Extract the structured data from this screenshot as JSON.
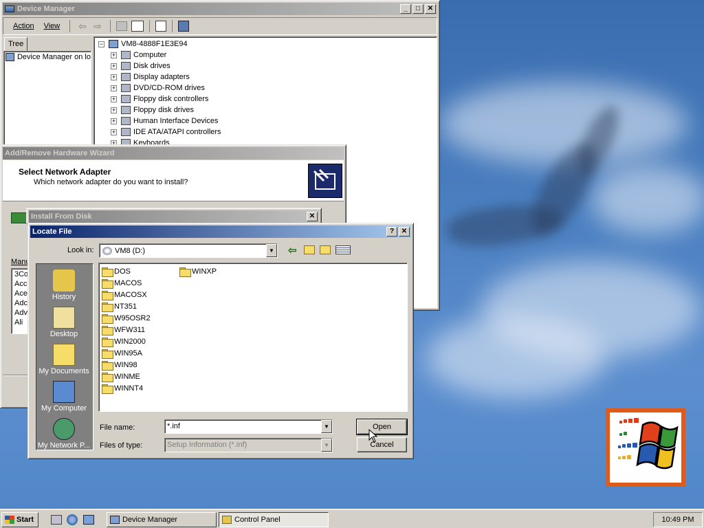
{
  "device_manager": {
    "title": "Device Manager",
    "menu": {
      "action": "Action",
      "view": "View"
    },
    "tab": "Tree",
    "left_item": "Device Manager on lo",
    "root": "VM8-4888F1E3E94",
    "categories": [
      "Computer",
      "Disk drives",
      "Display adapters",
      "DVD/CD-ROM drives",
      "Floppy disk controllers",
      "Floppy disk drives",
      "Human Interface Devices",
      "IDE ATA/ATAPI controllers",
      "Keyboards"
    ]
  },
  "wizard": {
    "title": "Add/Remove Hardware Wizard",
    "heading": "Select Network Adapter",
    "subheading": "Which network adapter do you want to install?",
    "manufacturer_label": "Manu",
    "manufacturers": [
      "3Co",
      "Acc",
      "Ace",
      "Adc",
      "Adv",
      "Ali"
    ]
  },
  "install_from_disk": {
    "title": "Install From Disk"
  },
  "locate_file": {
    "title": "Locate File",
    "look_in_label": "Look in:",
    "look_in_value": "VM8 (D:)",
    "places": [
      "History",
      "Desktop",
      "My Documents",
      "My Computer",
      "My Network P..."
    ],
    "folders_col1": [
      "DOS",
      "MACOS",
      "MACOSX",
      "NT351",
      "W95OSR2",
      "WFW311",
      "WIN2000",
      "WIN95A",
      "WIN98",
      "WINME",
      "WINNT4"
    ],
    "folders_col2": [
      "WINXP"
    ],
    "file_name_label": "File name:",
    "file_name_value": "*.inf",
    "file_type_label": "Files of type:",
    "file_type_value": "Setup Information (*.inf)",
    "open_label": "Open",
    "cancel_label": "Cancel"
  },
  "taskbar": {
    "start_label": "Start",
    "tasks": [
      "Device Manager",
      "Control Panel"
    ],
    "clock": "10:49 PM"
  }
}
